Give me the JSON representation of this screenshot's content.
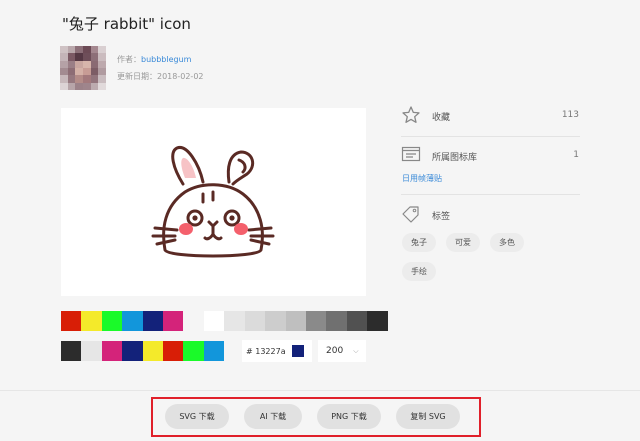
{
  "header": {
    "title": "\"兔子 rabbit\" icon",
    "author_prefix": "作者：",
    "author_name": "bubbblegum",
    "date_prefix": "更新日期：",
    "date": "2018-02-02"
  },
  "avatar": {
    "pixels": [
      "#cfc2c4",
      "#b9a7ab",
      "#8c6f78",
      "#6c4a55",
      "#a4878f",
      "#d9cfd1",
      "#c4b4b8",
      "#7b5964",
      "#553844",
      "#6e4e59",
      "#8d6f78",
      "#cbbcbf",
      "#b5a1a6",
      "#9a7e86",
      "#c9a6a0",
      "#d7b5ab",
      "#8a6a73",
      "#bda9ad",
      "#a38b91",
      "#8d6d75",
      "#d4b1a7",
      "#c79c95",
      "#7c5c65",
      "#b09ba0",
      "#c7b8bb",
      "#96787f",
      "#b48c88",
      "#a3797c",
      "#92747c",
      "#c9bcbf",
      "#dcd3d5",
      "#b7a5a9",
      "#9c8289",
      "#9f858c",
      "#bcabaf",
      "#e1dadb"
    ]
  },
  "palette": {
    "row1_colors": [
      "#d81e06",
      "#f4ea2a",
      "#1afa29",
      "#1296db",
      "#13227a",
      "#d4237a"
    ],
    "row1_grays": [
      "#ffffff",
      "#e6e6e6",
      "#dbdbdb",
      "#cdcdcd",
      "#bfbfbf",
      "#8a8a8a",
      "#707070",
      "#515151",
      "#2c2c2c"
    ],
    "row2_colors": [
      "#2c2c2c",
      "#e6e6e6",
      "#d4237a",
      "#13227a",
      "#f4ea2a",
      "#d81e06",
      "#1afa29",
      "#1296db"
    ],
    "hex_value": "# 13227a",
    "current_color": "#13227a",
    "size_value": "200"
  },
  "sidebar": {
    "favorite_label": "收藏",
    "favorite_count": "113",
    "library_label": "所属图标库",
    "library_count": "1",
    "library_link": "日用帧薄贴",
    "tags_label": "标签",
    "tags": [
      "兔子",
      "可爱",
      "多色",
      "手绘"
    ]
  },
  "actions": {
    "svg_download": "SVG 下载",
    "ai_download": "AI 下载",
    "png_download": "PNG 下载",
    "copy_svg": "复制 SVG"
  },
  "colors": {
    "highlight_border": "#e0202a",
    "link": "#3a8ad8",
    "icon_outline": "#5a2a24",
    "icon_blush": "#f4606c",
    "icon_ear_inner": "#f7c3c6"
  }
}
